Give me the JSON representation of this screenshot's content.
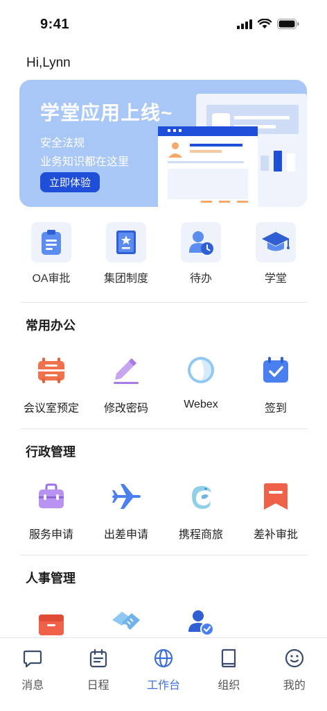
{
  "status": {
    "time": "9:41"
  },
  "greeting": "Hi,Lynn",
  "banner": {
    "title": "学堂应用上线~",
    "line1": "安全法规",
    "line2": "业务知识都在这里",
    "cta": "立即体验"
  },
  "quick": [
    {
      "label": "OA审批",
      "icon": "clipboard-icon"
    },
    {
      "label": "集团制度",
      "icon": "rulebook-icon"
    },
    {
      "label": "待办",
      "icon": "user-clock-icon"
    },
    {
      "label": "学堂",
      "icon": "graduation-cap-icon"
    }
  ],
  "sections": [
    {
      "title": "常用办公",
      "items": [
        {
          "label": "会议室预定",
          "icon": "meeting-room-icon"
        },
        {
          "label": "修改密码",
          "icon": "pencil-icon"
        },
        {
          "label": "Webex",
          "icon": "webex-icon"
        },
        {
          "label": "签到",
          "icon": "calendar-check-icon"
        }
      ]
    },
    {
      "title": "行政管理",
      "items": [
        {
          "label": "服务申请",
          "icon": "briefcase-icon"
        },
        {
          "label": "出差申请",
          "icon": "airplane-icon"
        },
        {
          "label": "携程商旅",
          "icon": "ctrip-dolphin-icon"
        },
        {
          "label": "差补审批",
          "icon": "ribbon-bookmark-icon"
        }
      ]
    },
    {
      "title": "人事管理",
      "items": [
        {
          "label": "",
          "icon": "archive-box-icon"
        },
        {
          "label": "",
          "icon": "handshake-icon"
        },
        {
          "label": "",
          "icon": "user-verified-icon"
        }
      ]
    }
  ],
  "tabs": [
    {
      "label": "消息",
      "icon": "chat-icon",
      "active": false
    },
    {
      "label": "日程",
      "icon": "calendar-icon",
      "active": false
    },
    {
      "label": "工作台",
      "icon": "globe-icon",
      "active": true
    },
    {
      "label": "组织",
      "icon": "book-icon",
      "active": false
    },
    {
      "label": "我的",
      "icon": "smile-icon",
      "active": false
    }
  ],
  "colors": {
    "accent": "#3d6fd9",
    "banner_bg": "#a8c7f7",
    "button_blue": "#1f4ed8",
    "tile_bg": "#eef2fb"
  }
}
